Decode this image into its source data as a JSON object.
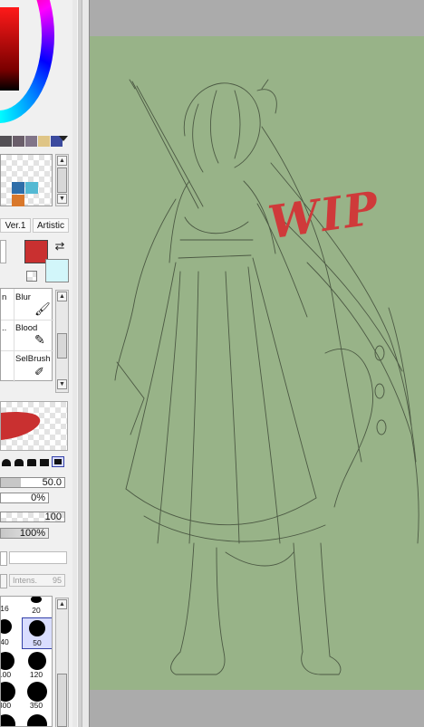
{
  "colors": {
    "canvas_bg": "#98b388",
    "primary": "#c93030",
    "secondary": "#d2f6fa",
    "wip": "#cf3a3a"
  },
  "palette_swatches": [
    "#535055",
    "#6a5e6a",
    "#817589",
    "#dfc586",
    "#3b4a9e"
  ],
  "mixer_swatches": [
    "#2f6ea9",
    "#54b9d3",
    "#d9782b"
  ],
  "tabs": [
    "Ver.1",
    "Artistic"
  ],
  "tools": [
    {
      "label": "Blur"
    },
    {
      "label": "Blood"
    },
    {
      "label": "SelBrush"
    }
  ],
  "sliders": {
    "size_value": "50.0",
    "min_size": "0%",
    "density": "100",
    "opacity": "100%"
  },
  "intensity": {
    "label": "Intens.",
    "value": "95"
  },
  "brush_sizes": [
    "16",
    "20",
    "40",
    "50",
    "100",
    "120",
    "300",
    "350"
  ],
  "canvas_text": "WIP"
}
